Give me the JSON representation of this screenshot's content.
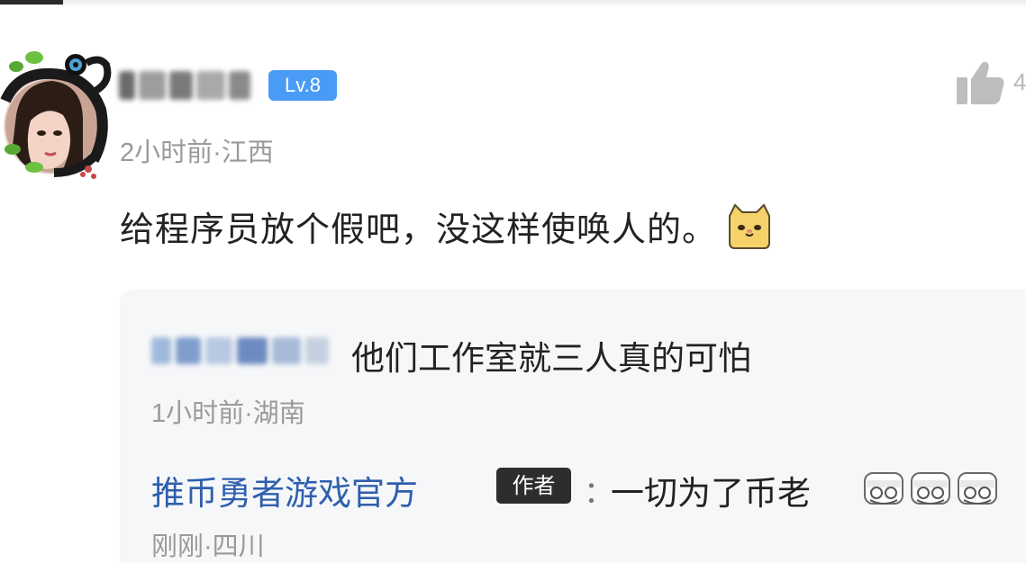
{
  "comment": {
    "level_badge": "Lv.8",
    "time": "2小时前",
    "location": "江西",
    "meta_text": "2小时前·江西",
    "body": "给程序员放个假吧，没这样使唤人的。",
    "body_emoji": "cat-emoji",
    "like_count": "4"
  },
  "replies": [
    {
      "text": "他们工作室就三人真的可怕",
      "meta_text": "1小时前·湖南"
    },
    {
      "author": "推币勇者游戏官方",
      "author_badge": "作者",
      "separator": "：",
      "text": "一切为了币老",
      "emoji": [
        "bill-emoji",
        "bill-emoji",
        "bill-emoji"
      ],
      "meta_text": "刚刚·四川"
    }
  ],
  "colors": {
    "level_badge": "#4a9bf5",
    "author_link": "#2f5fae",
    "reply_bg": "#f6f7f9",
    "meta_text": "#9a9a9a",
    "author_badge": "#2d2d2d"
  }
}
